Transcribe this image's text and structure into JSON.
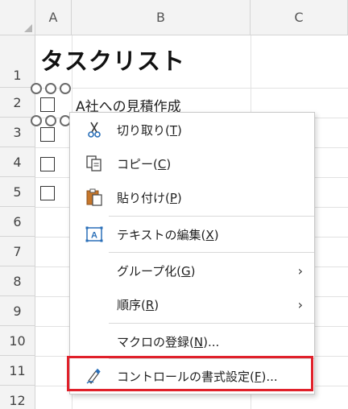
{
  "columns": [
    "A",
    "B",
    "C"
  ],
  "rows": [
    "1",
    "2",
    "3",
    "4",
    "5",
    "6",
    "7",
    "8",
    "9",
    "10",
    "11",
    "12"
  ],
  "sheet": {
    "title": "タスクリスト",
    "task_b2": "A社への見積作成"
  },
  "menu": {
    "items": [
      {
        "icon": "scissors-icon",
        "label": "切り取り(",
        "key": "T",
        "close": ")"
      },
      {
        "icon": "copy-icon",
        "label": "コピー(",
        "key": "C",
        "close": ")"
      },
      {
        "icon": "paste-icon",
        "label": "貼り付け(",
        "key": "P",
        "close": ")"
      },
      {
        "icon": "edit-text-icon",
        "label": "テキストの編集(",
        "key": "X",
        "close": ")"
      },
      {
        "icon": "",
        "label": "グループ化(",
        "key": "G",
        "close": ")",
        "submenu": true
      },
      {
        "icon": "",
        "label": "順序(",
        "key": "R",
        "close": ")",
        "submenu": true
      },
      {
        "icon": "",
        "label": "マクロの登録(",
        "key": "N",
        "close": ")..."
      },
      {
        "icon": "format-control-icon",
        "label": "コントロールの書式設定(",
        "key": "F",
        "close": ")..."
      }
    ],
    "submenu_arrow": "›"
  },
  "colors": {
    "highlight": "#e0202a",
    "icon_blue": "#2a6fb8",
    "icon_orange": "#c6762a"
  }
}
